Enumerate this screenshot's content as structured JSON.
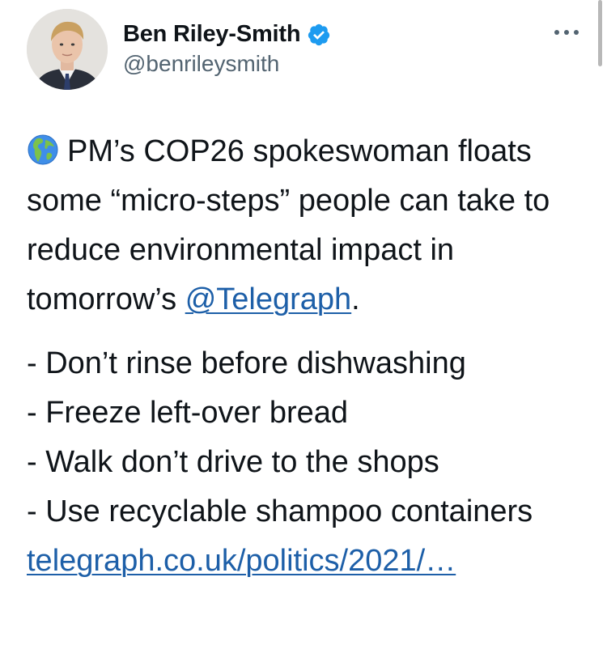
{
  "author": {
    "display_name": "Ben Riley-Smith",
    "handle": "@benrileysmith",
    "verified": true
  },
  "tweet": {
    "globe_emoji": "globe-europe-africa-icon",
    "paragraph_1_before_mention": "PM’s COP26 spokeswoman floats some “micro-steps” people can take to reduce environmental impact in tomorrow’s",
    "mention": "@Telegraph",
    "paragraph_1_after_mention": ".",
    "list_items": [
      "- Don’t rinse before dishwashing",
      "- Freeze left-over bread",
      "- Walk don’t drive to the shops",
      "- Use recyclable shampoo containers"
    ],
    "link": "telegraph.co.uk/politics/2021/…"
  },
  "colors": {
    "text": "#0f1419",
    "secondary": "#536471",
    "link": "#1d5fa8",
    "verified": "#1d9bf0"
  }
}
